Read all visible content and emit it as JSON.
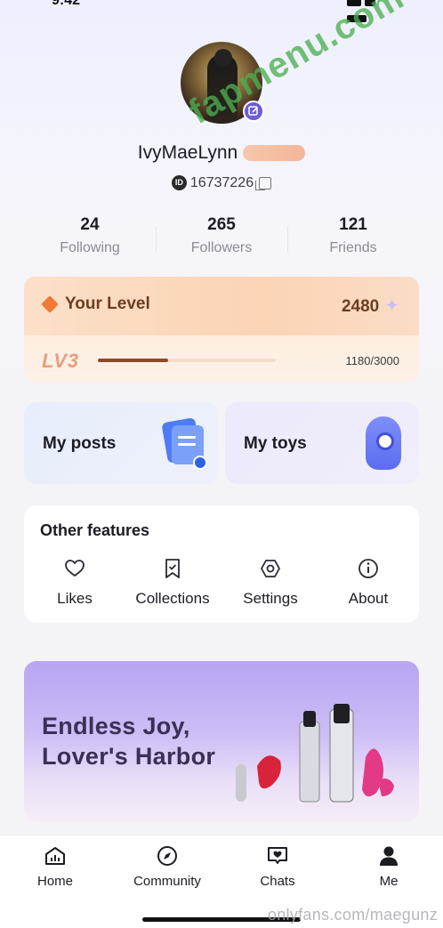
{
  "status_bar": {
    "time": "9:42"
  },
  "profile": {
    "username": "IvyMaeLynn",
    "id_badge": "ID",
    "user_id": "16737226"
  },
  "watermark": "fapmenu.com",
  "stats": [
    {
      "value": "24",
      "label": "Following"
    },
    {
      "value": "265",
      "label": "Followers"
    },
    {
      "value": "121",
      "label": "Friends"
    }
  ],
  "level": {
    "title": "Your Level",
    "points": "2480",
    "lv_label": "LV3",
    "progress_text": "1180/3000",
    "progress_fraction": 0.393
  },
  "tiles": {
    "posts": "My posts",
    "toys": "My toys"
  },
  "features": {
    "title": "Other features",
    "items": [
      {
        "label": "Likes",
        "icon": "heart-icon"
      },
      {
        "label": "Collections",
        "icon": "bookmark-icon"
      },
      {
        "label": "Settings",
        "icon": "settings-hexagon-icon"
      },
      {
        "label": "About",
        "icon": "info-icon"
      }
    ]
  },
  "banner": {
    "line1": "Endless Joy,",
    "line2": "Lover's Harbor"
  },
  "tabbar": [
    {
      "label": "Home",
      "icon": "home-chart-icon"
    },
    {
      "label": "Community",
      "icon": "compass-icon"
    },
    {
      "label": "Chats",
      "icon": "chat-heart-icon"
    },
    {
      "label": "Me",
      "icon": "person-icon"
    }
  ],
  "site_mark": "onlyfans.com/maegunz",
  "colors": {
    "accent": "#6e5bd8",
    "level_text": "#6b3e22",
    "progress": "#8a4a2c",
    "watermark": "#4caf50"
  }
}
